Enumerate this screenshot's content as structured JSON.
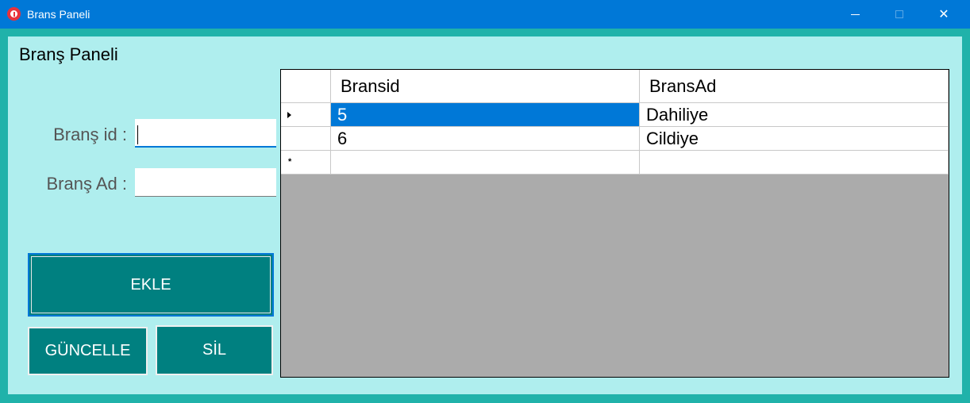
{
  "window": {
    "title": "Brans Paneli",
    "close_glyph": "✕"
  },
  "form": {
    "title": "Branş Paneli",
    "id_label": "Branş id :",
    "id_value": "",
    "ad_label": "Branş Ad :",
    "ad_value": ""
  },
  "buttons": {
    "add": "EKLE",
    "update": "GÜNCELLE",
    "delete": "SİL"
  },
  "grid": {
    "columns": [
      "Bransid",
      "BransAd"
    ],
    "rows": [
      {
        "id": "5",
        "name": "Dahiliye",
        "selected": true
      },
      {
        "id": "6",
        "name": "Cildiye",
        "selected": false
      }
    ],
    "new_row_marker": "*"
  },
  "colors": {
    "titlebar": "#0078d7",
    "form_background": "#afeeee",
    "frame": "#20b2aa",
    "button": "#008080",
    "selection": "#0078d7",
    "grid_empty": "#ababab"
  },
  "icons": {
    "app": "app-icon",
    "minimize": "minimize-icon",
    "maximize": "maximize-icon",
    "close": "close-icon",
    "current_row": "row-pointer-icon",
    "new_row": "new-row-icon"
  }
}
